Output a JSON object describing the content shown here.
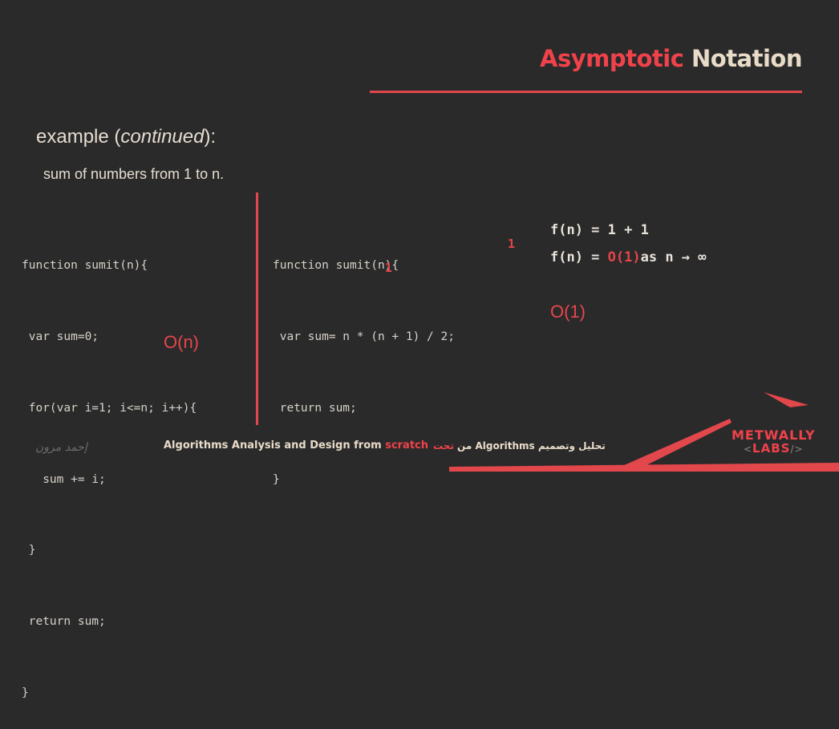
{
  "header": {
    "title_part1": "Asymptotic",
    "title_part2": "Notation"
  },
  "slide": {
    "heading_prefix": "example (",
    "heading_italic": "continued",
    "heading_suffix": "):",
    "subheading": "sum of numbers from 1 to n."
  },
  "code_left": {
    "lines": [
      "function sumit(n){",
      " var sum=0;",
      " for(var i=1; i<=n; i++){",
      "   sum += i;",
      " }",
      " return sum;",
      "}"
    ],
    "complexity": "O(n)"
  },
  "code_middle": {
    "lines": [
      "function sumit(n){",
      " var sum= n * (n + 1) / 2;",
      " return sum;",
      "}"
    ],
    "cost_line1": "1",
    "cost_line2": "1"
  },
  "analysis": {
    "line1": "f(n) = 1 + 1",
    "line2_prefix": "f(n) = ",
    "line2_highlight": "O(1)",
    "line2_suffix": "as n → ∞",
    "result": "O(1)"
  },
  "footer": {
    "course_prefix": "Algorithms Analysis and Design from ",
    "course_highlight": "scratch",
    "arabic_main": "تحليل وتصميم Algorithms من ",
    "arabic_highlight": "تحت",
    "signature": "إحمد مرون"
  },
  "logo": {
    "line1": "METWALLY",
    "line2": "LABS",
    "bracket_open": "<",
    "bracket_close": "/>"
  },
  "colors": {
    "background": "#2a2a2b",
    "accent": "#e8454b",
    "cream": "#e8dcc8"
  }
}
